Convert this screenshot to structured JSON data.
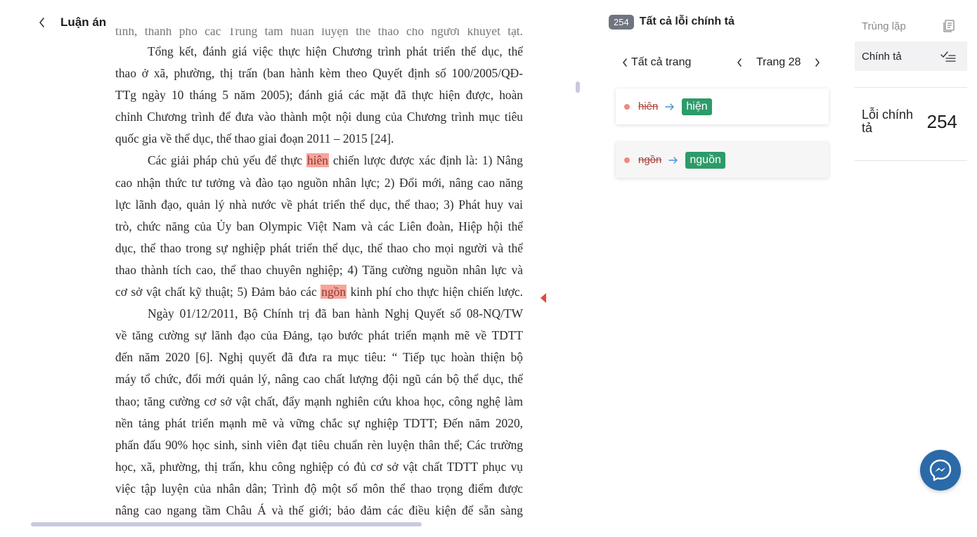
{
  "header": {
    "title": "Luận án"
  },
  "document": {
    "lines": [
      {
        "text": "tỉnh, thành phố các Trung tâm huấn luyện thể thao cho người khuyết tật.",
        "cls": "cut"
      },
      {
        "text": "Tổng kết, đánh giá việc thực hiện Chương trình phát triển thể dục, thể",
        "cls": "indent"
      },
      {
        "text": "thao ở xã, phường, thị trấn (ban hành kèm theo Quyết định số 100/2005/QĐ-",
        "cls": ""
      },
      {
        "text": "TTg ngày 10 tháng 5 năm 2005); đánh giá các mặt đã thực hiện được, hoàn",
        "cls": ""
      },
      {
        "text": "chỉnh Chương trình để đưa vào thành một nội dung của Chương trình mục tiêu",
        "cls": ""
      },
      {
        "text": "quốc gia về thể dục, thể thao giai đoạn 2011 – 2015 [24].",
        "cls": "last"
      },
      {
        "pre": "Các giải pháp chủ yếu để thực ",
        "hl": "hiên",
        "post": " chiến lược được xác định là: 1) Nâng",
        "cls": "indent"
      },
      {
        "text": "cao nhận thức tư tưởng và đào tạo nguồn nhân lực; 2) Đổi mới, nâng cao năng",
        "cls": ""
      },
      {
        "text": "lực lãnh đạo, quản lý nhà nước về phát triển thể dục, thể thao; 3) Phát huy vai",
        "cls": ""
      },
      {
        "text": "trò, chức năng của Ủy ban Olympic Việt Nam và các Liên đoàn, Hiệp hội thể",
        "cls": ""
      },
      {
        "text": "dục, thể thao trong sự nghiệp phát triển thể dục, thể thao cho mọi người và thể",
        "cls": ""
      },
      {
        "text": "thao thành tích cao, thể thao chuyên nghiệp; 4) Tăng cường nguồn nhân lực và",
        "cls": ""
      },
      {
        "pre": "cơ sở vật chất kỹ thuật; 5) Đảm bảo các ",
        "hl": "ngồn",
        "post": " kinh phí cho thực hiện chiến lược.",
        "cls": ""
      },
      {
        "text": "Ngày 01/12/2011, Bộ Chính trị đã ban hành Nghị Quyết số 08-NQ/TW",
        "cls": "indent"
      },
      {
        "text": "về tăng cường sự lãnh đạo của Đảng, tạo bước phát triển mạnh mẽ về TDTT",
        "cls": ""
      },
      {
        "text": "đến năm 2020 [6]. Nghị quyết đã đưa ra  mục tiêu: “ Tiếp tục hoàn thiện bộ",
        "cls": ""
      },
      {
        "text": "máy tổ chức, đổi mới quản lý, nâng cao chất lượng đội ngũ cán bộ thể dục, thể",
        "cls": ""
      },
      {
        "text": "thao; tăng cường cơ sở vật chất, đẩy mạnh nghiên cứu khoa học, công nghệ làm",
        "cls": ""
      },
      {
        "text": "nền tảng phát triển mạnh mẽ và vững chắc sự nghiệp TDTT; Đến năm 2020,",
        "cls": ""
      },
      {
        "text": "phấn đấu 90% học sinh, sinh viên đạt tiêu chuẩn rèn luyện thân thể; Các trường",
        "cls": ""
      },
      {
        "text": "học, xã, phường, thị trấn, khu công nghiệp có đủ cơ sở vật chất TDTT phục vụ",
        "cls": ""
      },
      {
        "text": "việc tập luyện của nhân dân; Trình độ một số môn thể thao trọng điểm được",
        "cls": ""
      },
      {
        "text": "nâng cao ngang tầm Châu Á và thế giới; bảo đảm các điều kiện để sẵn sàng",
        "cls": ""
      }
    ]
  },
  "errors_panel": {
    "count": "254",
    "title": "Tất cả lỗi chính tả",
    "all_pages": "Tất cả trang",
    "page_label": "Trang 28",
    "items": [
      {
        "wrong": "hiên",
        "fix": "hiện"
      },
      {
        "wrong": "ngồn",
        "fix": "nguồn"
      }
    ]
  },
  "sidebar": {
    "duplicate": "Trùng lặp",
    "spelling": "Chính tả",
    "stat_label": "Lỗi chính tả",
    "stat_value": "254"
  },
  "colors": {
    "highlight": "#f7a59a",
    "fix_badge": "#2d9b6a",
    "count_badge": "#6f7480",
    "messenger": "#2b6aa8",
    "marker": "#e5483a"
  }
}
